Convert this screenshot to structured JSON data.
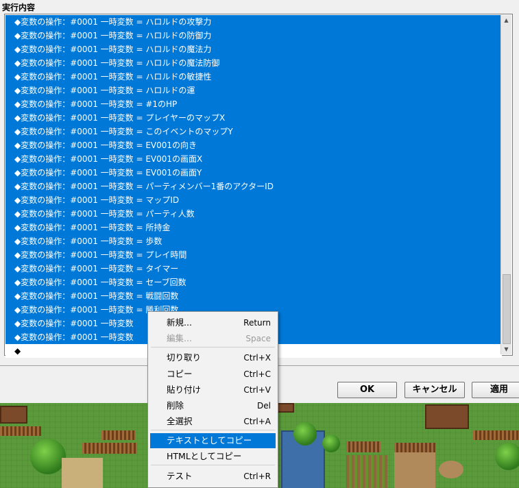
{
  "window": {
    "title": "実行内容"
  },
  "list": {
    "rows": [
      "◆変数の操作：#0001 一時変数 = ハロルドの攻撃力",
      "◆変数の操作：#0001 一時変数 = ハロルドの防御力",
      "◆変数の操作：#0001 一時変数 = ハロルドの魔法力",
      "◆変数の操作：#0001 一時変数 = ハロルドの魔法防御",
      "◆変数の操作：#0001 一時変数 = ハロルドの敏捷性",
      "◆変数の操作：#0001 一時変数 = ハロルドの運",
      "◆変数の操作：#0001 一時変数 = #1のHP",
      "◆変数の操作：#0001 一時変数 = プレイヤーのマップX",
      "◆変数の操作：#0001 一時変数 = このイベントのマップY",
      "◆変数の操作：#0001 一時変数 = EV001の向き",
      "◆変数の操作：#0001 一時変数 = EV001の画面X",
      "◆変数の操作：#0001 一時変数 = EV001の画面Y",
      "◆変数の操作：#0001 一時変数 = パーティメンバー1番のアクターID",
      "◆変数の操作：#0001 一時変数 = マップID",
      "◆変数の操作：#0001 一時変数 = パーティ人数",
      "◆変数の操作：#0001 一時変数 = 所持金",
      "◆変数の操作：#0001 一時変数 = 歩数",
      "◆変数の操作：#0001 一時変数 = プレイ時間",
      "◆変数の操作：#0001 一時変数 = タイマー",
      "◆変数の操作：#0001 一時変数 = セーブ回数",
      "◆変数の操作：#0001 一時変数 = 戦闘回数",
      "◆変数の操作：#0001 一時変数 = 勝利回数",
      "◆変数の操作：#0001 一時変数",
      "◆変数の操作：#0001 一時変数"
    ],
    "empty_row": "◆"
  },
  "buttons": {
    "ok": "OK",
    "cancel": "キャンセル",
    "apply": "適用"
  },
  "context_menu": {
    "items": [
      {
        "label": "新規...",
        "shortcut": "Return",
        "enabled": true
      },
      {
        "label": "編集...",
        "shortcut": "Space",
        "enabled": false
      },
      {
        "label": "切り取り",
        "shortcut": "Ctrl+X",
        "enabled": true
      },
      {
        "label": "コピー",
        "shortcut": "Ctrl+C",
        "enabled": true
      },
      {
        "label": "貼り付け",
        "shortcut": "Ctrl+V",
        "enabled": true
      },
      {
        "label": "削除",
        "shortcut": "Del",
        "enabled": true
      },
      {
        "label": "全選択",
        "shortcut": "Ctrl+A",
        "enabled": true
      },
      {
        "label": "テキストとしてコピー",
        "shortcut": "",
        "enabled": true,
        "highlighted": true
      },
      {
        "label": "HTMLとしてコピー",
        "shortcut": "",
        "enabled": true
      },
      {
        "label": "テスト",
        "shortcut": "Ctrl+R",
        "enabled": true
      }
    ]
  },
  "colors": {
    "selection": "#0078d7",
    "list_bg": "#ffffff",
    "window_bg": "#f0f0f0"
  },
  "icons": {
    "scroll_up": "triangle-up",
    "scroll_down": "triangle-down"
  }
}
